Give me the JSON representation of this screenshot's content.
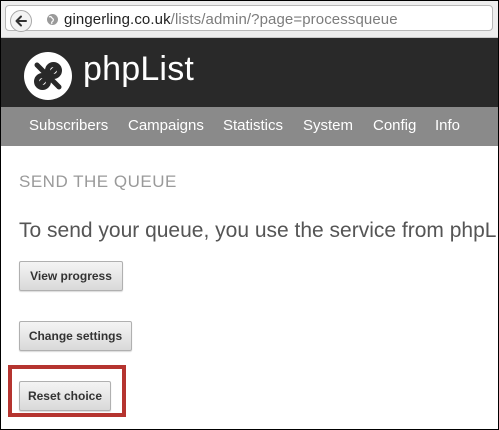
{
  "browser": {
    "url_host": "gingerling.co.uk",
    "url_path": "/lists/admin/?page=processqueue"
  },
  "header": {
    "logo_text": "phpList"
  },
  "nav": {
    "items": [
      {
        "label": "Subscribers"
      },
      {
        "label": "Campaigns"
      },
      {
        "label": "Statistics"
      },
      {
        "label": "System"
      },
      {
        "label": "Config"
      },
      {
        "label": "Info"
      }
    ]
  },
  "main": {
    "title": "SEND THE QUEUE",
    "intro": "To send your queue, you use the service from phpL",
    "buttons": {
      "view_progress": "View progress",
      "change_settings": "Change settings",
      "reset_choice": "Reset choice"
    }
  },
  "colors": {
    "header_bg": "#292929",
    "nav_bg": "#8a8a8a",
    "highlight": "#b5342f"
  }
}
